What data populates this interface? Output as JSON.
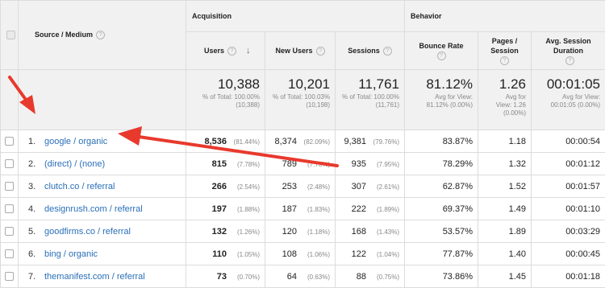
{
  "header": {
    "source_medium": "Source / Medium",
    "acquisition": "Acquisition",
    "behavior": "Behavior",
    "columns": {
      "users": "Users",
      "new_users": "New Users",
      "sessions": "Sessions",
      "bounce_rate": "Bounce Rate",
      "pages_session": "Pages / Session",
      "avg_duration": "Avg. Session Duration"
    },
    "help_glyph": "?",
    "sort_glyph": "↓"
  },
  "totals": {
    "users": {
      "value": "10,388",
      "sub1": "% of Total: 100.00%",
      "sub2": "(10,388)"
    },
    "new_users": {
      "value": "10,201",
      "sub1": "% of Total: 100.03%",
      "sub2": "(10,198)"
    },
    "sessions": {
      "value": "11,761",
      "sub1": "% of Total: 100.00%",
      "sub2": "(11,761)"
    },
    "bounce_rate": {
      "value": "81.12%",
      "sub1": "Avg for View:",
      "sub2": "81.12% (0.00%)"
    },
    "pages_session": {
      "value": "1.26",
      "sub1": "Avg for",
      "sub2": "View: 1.26",
      "sub3": "(0.00%)"
    },
    "avg_duration": {
      "value": "00:01:05",
      "sub1": "Avg for View:",
      "sub2": "00:01:05 (0.00%)"
    }
  },
  "rows": [
    {
      "idx": "1.",
      "source": "google / organic",
      "users": "8,536",
      "users_pct": "(81.44%)",
      "new_users": "8,374",
      "new_users_pct": "(82.09%)",
      "sessions": "9,381",
      "sessions_pct": "(79.76%)",
      "bounce": "83.87%",
      "pages": "1.18",
      "duration": "00:00:54"
    },
    {
      "idx": "2.",
      "source": "(direct) / (none)",
      "users": "815",
      "users_pct": "(7.78%)",
      "new_users": "789",
      "new_users_pct": "(7.73%)",
      "sessions": "935",
      "sessions_pct": "(7.95%)",
      "bounce": "78.29%",
      "pages": "1.32",
      "duration": "00:01:12"
    },
    {
      "idx": "3.",
      "source": "clutch.co / referral",
      "users": "266",
      "users_pct": "(2.54%)",
      "new_users": "253",
      "new_users_pct": "(2.48%)",
      "sessions": "307",
      "sessions_pct": "(2.61%)",
      "bounce": "62.87%",
      "pages": "1.52",
      "duration": "00:01:57"
    },
    {
      "idx": "4.",
      "source": "designrush.com / referral",
      "users": "197",
      "users_pct": "(1.88%)",
      "new_users": "187",
      "new_users_pct": "(1.83%)",
      "sessions": "222",
      "sessions_pct": "(1.89%)",
      "bounce": "69.37%",
      "pages": "1.49",
      "duration": "00:01:10"
    },
    {
      "idx": "5.",
      "source": "goodfirms.co / referral",
      "users": "132",
      "users_pct": "(1.26%)",
      "new_users": "120",
      "new_users_pct": "(1.18%)",
      "sessions": "168",
      "sessions_pct": "(1.43%)",
      "bounce": "53.57%",
      "pages": "1.89",
      "duration": "00:03:29"
    },
    {
      "idx": "6.",
      "source": "bing / organic",
      "users": "110",
      "users_pct": "(1.05%)",
      "new_users": "108",
      "new_users_pct": "(1.06%)",
      "sessions": "122",
      "sessions_pct": "(1.04%)",
      "bounce": "77.87%",
      "pages": "1.40",
      "duration": "00:00:45"
    },
    {
      "idx": "7.",
      "source": "themanifest.com / referral",
      "users": "73",
      "users_pct": "(0.70%)",
      "new_users": "64",
      "new_users_pct": "(0.63%)",
      "sessions": "88",
      "sessions_pct": "(0.75%)",
      "bounce": "73.86%",
      "pages": "1.45",
      "duration": "00:01:18"
    }
  ],
  "colors": {
    "link": "#2a6fb8",
    "annotation_arrow": "#e8392d",
    "header_bg": "#f1f1f1"
  }
}
